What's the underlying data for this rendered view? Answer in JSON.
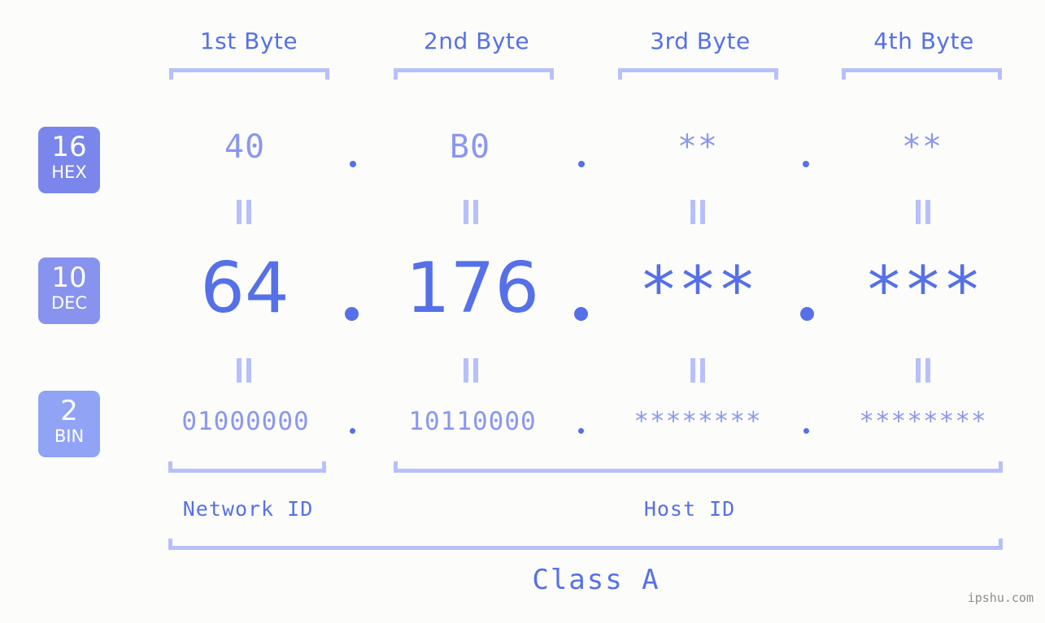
{
  "page": {
    "background_color": "#fcfdfa",
    "accent_color": "#5570e8",
    "light_accent_color": "#8a97f0",
    "bracket_color": "#b7c0fb",
    "watermark": "ipshu.com"
  },
  "byte_headers": [
    {
      "label": "1st Byte"
    },
    {
      "label": "2nd Byte"
    },
    {
      "label": "3rd Byte"
    },
    {
      "label": "4th Byte"
    }
  ],
  "bases": [
    {
      "number": "16",
      "abbr": "HEX",
      "color": "#7b86ec"
    },
    {
      "number": "10",
      "abbr": "DEC",
      "color": "#8793ef"
    },
    {
      "number": "2",
      "abbr": "BIN",
      "color": "#90a3f4"
    }
  ],
  "rows": {
    "hex": {
      "base_number": "16",
      "base_abbr": "HEX",
      "values": [
        "40",
        "B0",
        "**",
        "**"
      ],
      "separator": "."
    },
    "dec": {
      "base_number": "10",
      "base_abbr": "DEC",
      "values": [
        "64",
        "176",
        "***",
        "***"
      ],
      "separator": "."
    },
    "bin": {
      "base_number": "2",
      "base_abbr": "BIN",
      "values": [
        "01000000",
        "10110000",
        "********",
        "********"
      ],
      "separator": "."
    }
  },
  "equals_symbol": "=",
  "footer": {
    "network_id_label": "Network ID",
    "host_id_label": "Host ID",
    "class_label": "Class A"
  }
}
